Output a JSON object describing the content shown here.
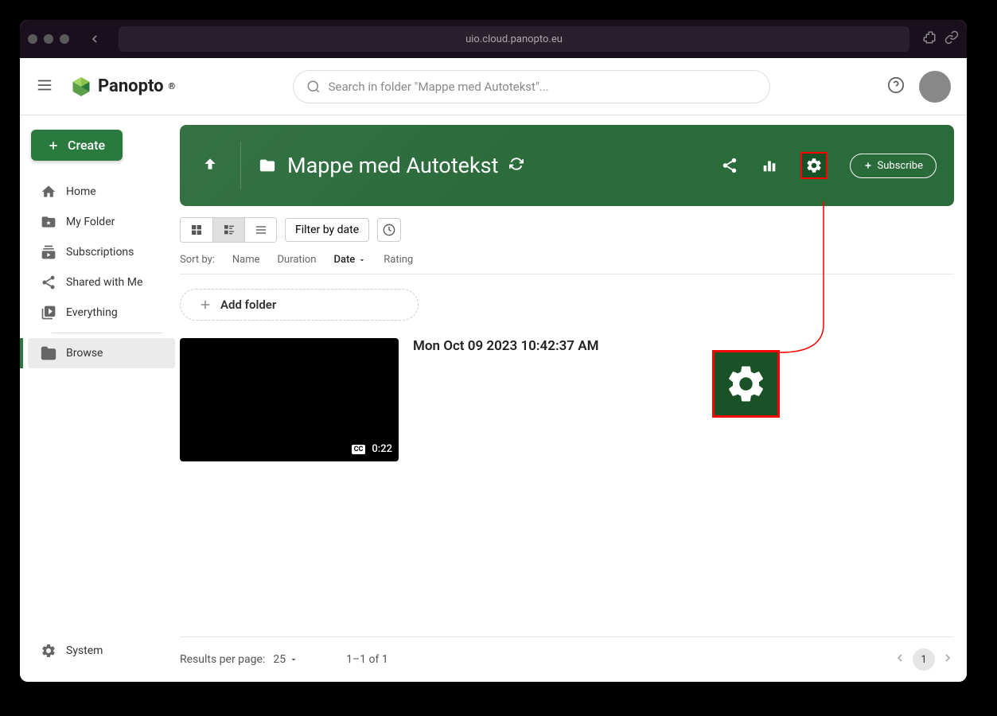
{
  "browser": {
    "url": "uio.cloud.panopto.eu"
  },
  "header": {
    "brand": "Panopto",
    "search_placeholder": "Search in folder \"Mappe med Autotekst\"..."
  },
  "sidebar": {
    "create_label": "Create",
    "items": [
      {
        "label": "Home"
      },
      {
        "label": "My Folder"
      },
      {
        "label": "Subscriptions"
      },
      {
        "label": "Shared with Me"
      },
      {
        "label": "Everything"
      },
      {
        "label": "Browse"
      }
    ],
    "system_label": "System"
  },
  "folder": {
    "title": "Mappe med Autotekst",
    "subscribe_label": "Subscribe"
  },
  "toolbar": {
    "filter_label": "Filter by date",
    "sort_by_label": "Sort by:",
    "sort_options": {
      "name": "Name",
      "duration": "Duration",
      "date": "Date",
      "rating": "Rating"
    },
    "add_folder_label": "Add folder"
  },
  "content": {
    "video": {
      "title": "Mon Oct 09 2023 10:42:37 AM",
      "duration": "0:22",
      "cc": "CC"
    }
  },
  "footer": {
    "results_label": "Results per page:",
    "per_page": "25",
    "range": "1–1 of 1",
    "page": "1"
  }
}
